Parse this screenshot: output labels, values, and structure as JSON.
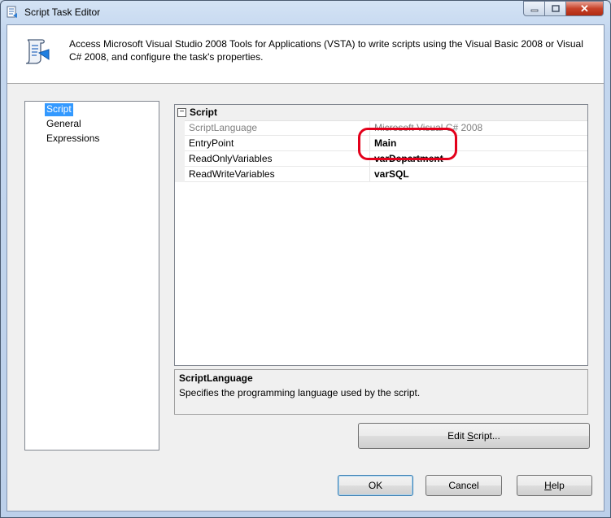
{
  "window": {
    "title": "Script Task Editor",
    "close_glyph": "✕"
  },
  "header": {
    "description": "Access Microsoft Visual Studio 2008 Tools for Applications (VSTA) to write scripts using the Visual Basic 2008 or Visual C# 2008, and configure the task's properties."
  },
  "nav": {
    "items": [
      {
        "label": "Script",
        "selected": true
      },
      {
        "label": "General",
        "selected": false
      },
      {
        "label": "Expressions",
        "selected": false
      }
    ]
  },
  "property_grid": {
    "category": "Script",
    "category_toggle": "−",
    "rows": [
      {
        "name": "ScriptLanguage",
        "value": "Microsoft Visual C# 2008"
      },
      {
        "name": "EntryPoint",
        "value": "Main"
      },
      {
        "name": "ReadOnlyVariables",
        "value": "varDepartment"
      },
      {
        "name": "ReadWriteVariables",
        "value": "varSQL"
      }
    ]
  },
  "description_panel": {
    "title": "ScriptLanguage",
    "text": "Specifies the programming language used by the script."
  },
  "buttons": {
    "edit_script": {
      "pre": "Edit ",
      "mnemonic": "S",
      "post": "cript..."
    },
    "ok": "OK",
    "cancel": "Cancel",
    "help": {
      "mnemonic": "H",
      "post": "elp"
    }
  },
  "colors": {
    "highlight": "#e3001b",
    "selection": "#3399ff"
  }
}
